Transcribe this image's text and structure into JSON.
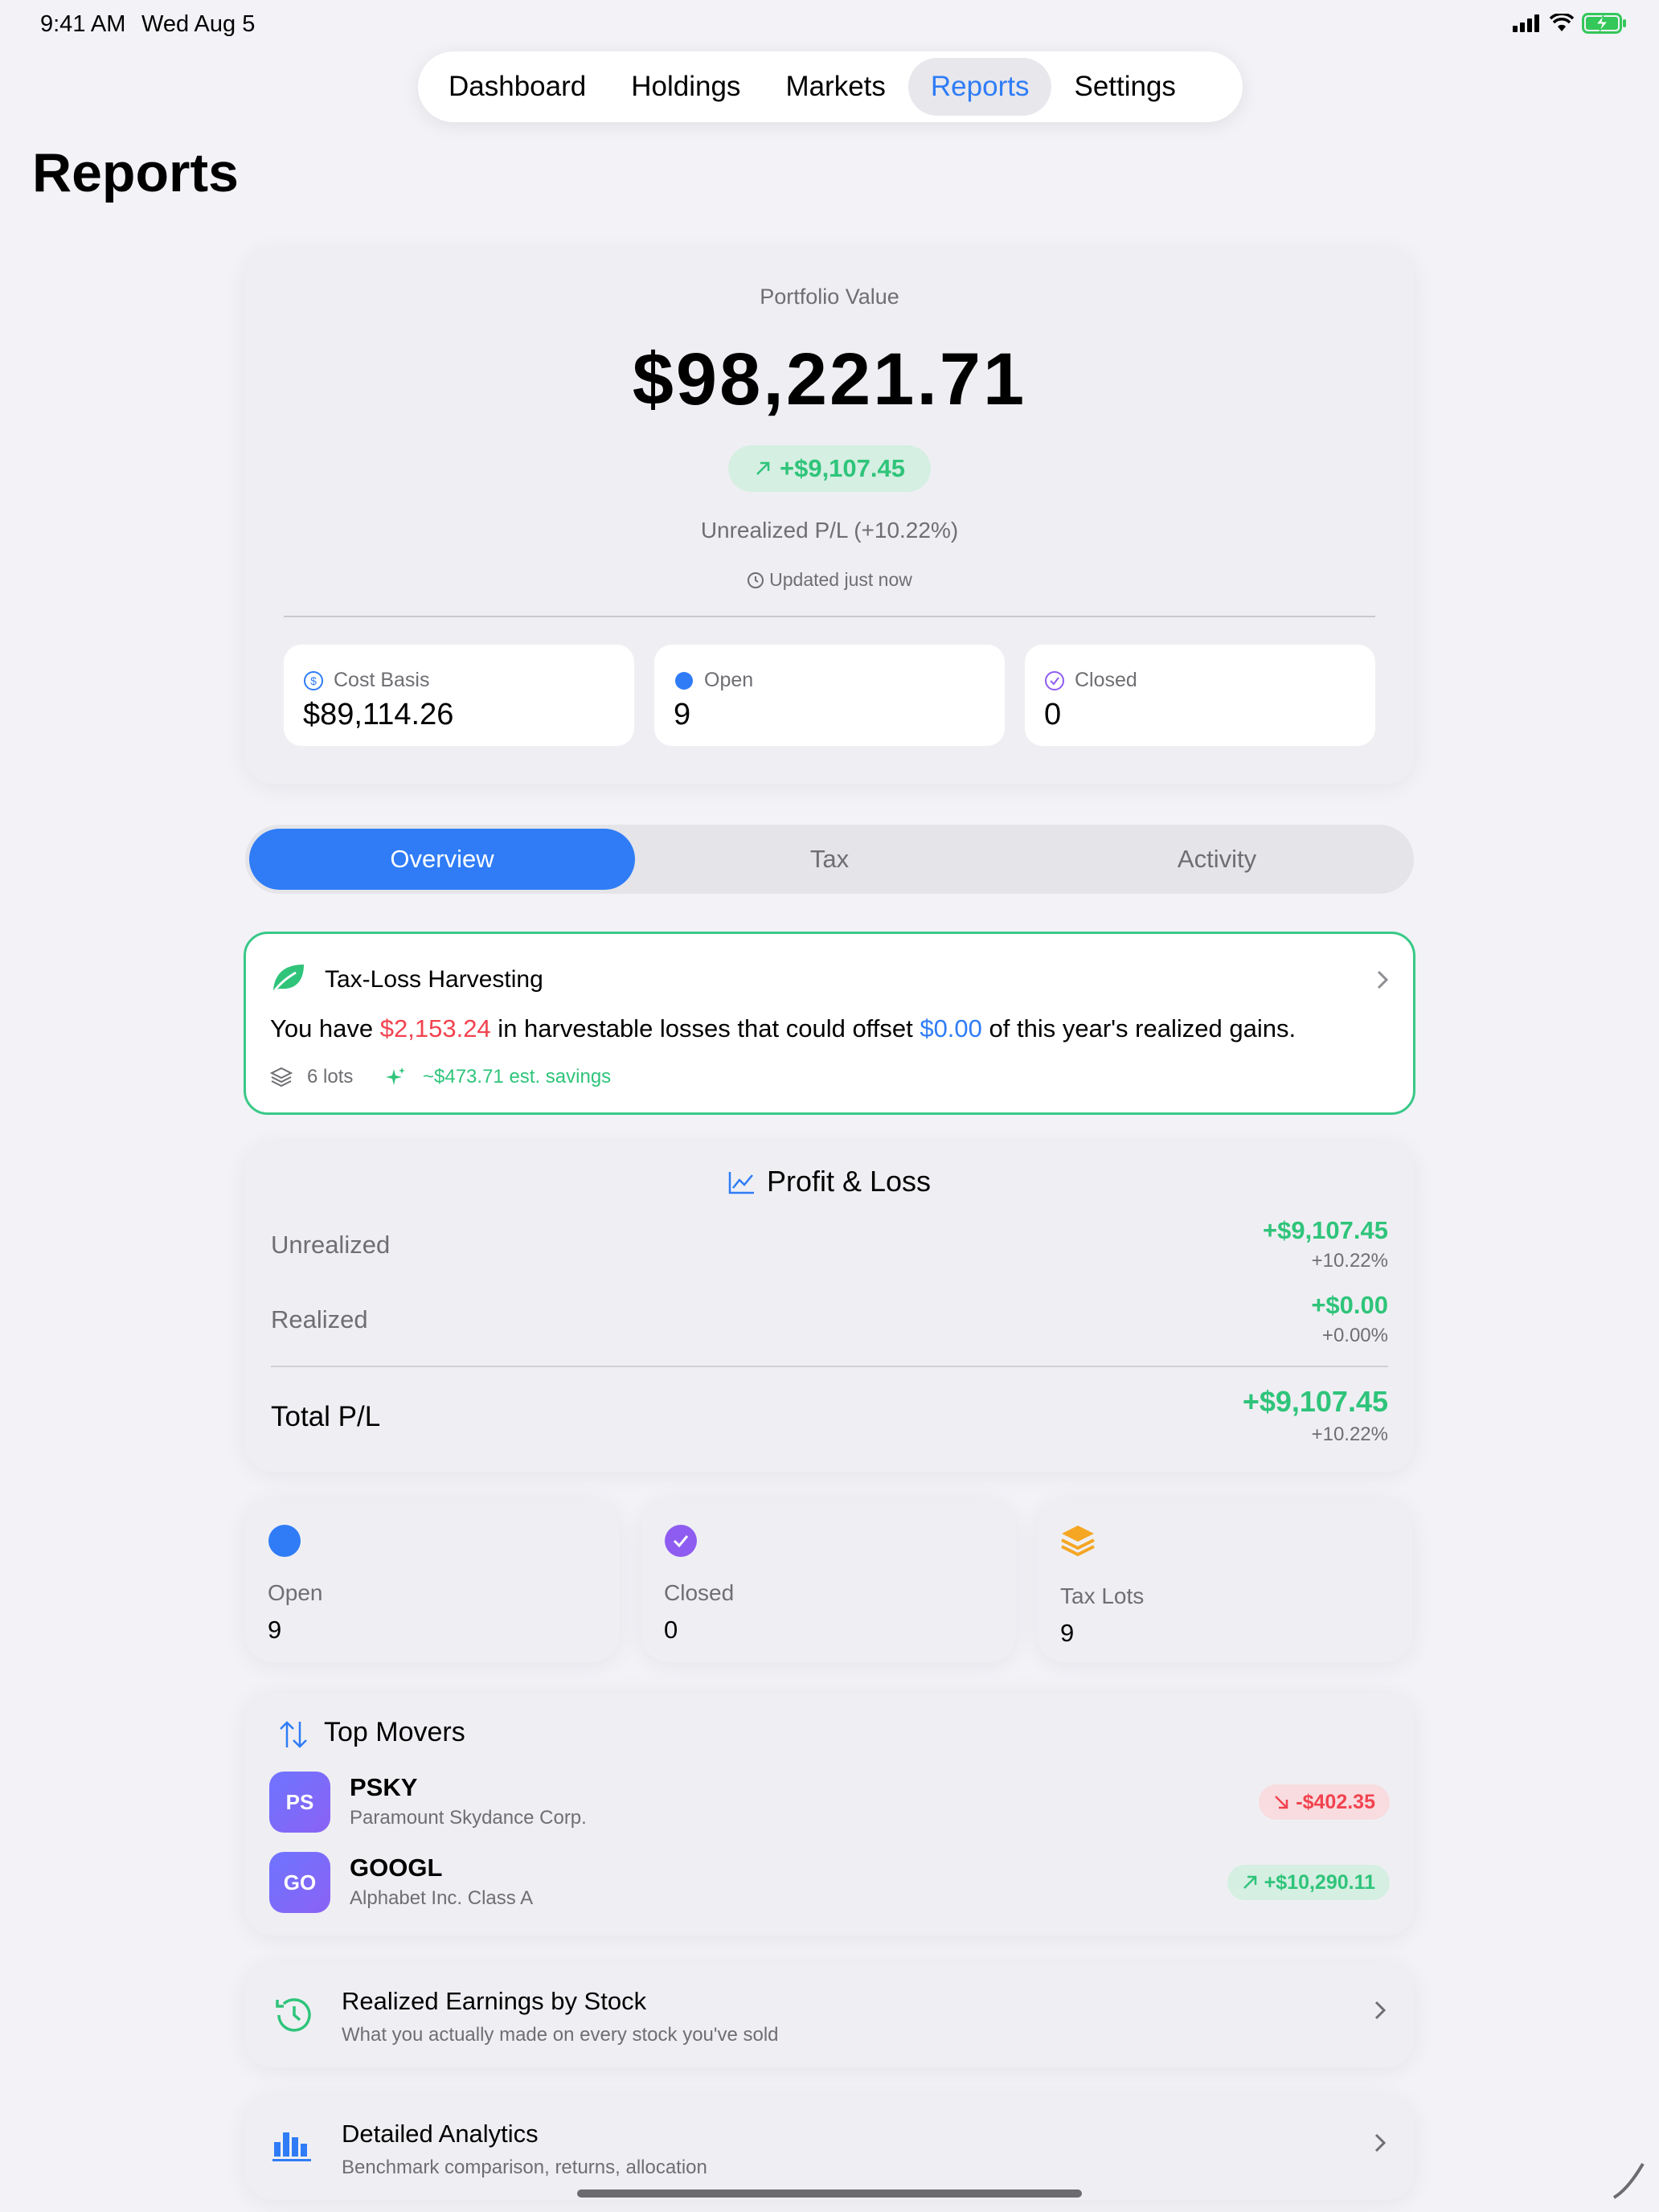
{
  "status": {
    "time": "9:41 AM",
    "date": "Wed Aug 5"
  },
  "nav": {
    "items": [
      "Dashboard",
      "Holdings",
      "Markets",
      "Reports",
      "Settings"
    ],
    "active": "Reports"
  },
  "page": {
    "title": "Reports"
  },
  "portfolio": {
    "label": "Portfolio Value",
    "value": "$98,221.71",
    "change": "+$9,107.45",
    "unrealized": "Unrealized P/L (+10.22%)",
    "updated": "Updated just now",
    "stats": [
      {
        "label": "Cost Basis",
        "value": "$89,114.26",
        "icon": "dollar-circle-icon"
      },
      {
        "label": "Open",
        "value": "9",
        "icon": "blue-dot-icon"
      },
      {
        "label": "Closed",
        "value": "0",
        "icon": "check-circle-icon"
      }
    ]
  },
  "segments": {
    "items": [
      "Overview",
      "Tax",
      "Activity"
    ],
    "active": "Overview"
  },
  "tax_loss": {
    "title": "Tax-Loss Harvesting",
    "text_1": "You have ",
    "losses": "$2,153.24",
    "text_2": " in harvestable losses that could offset ",
    "offset": "$0.00",
    "text_3": " of this year's realized gains.",
    "lots": "6 lots",
    "savings": "~$473.71 est. savings"
  },
  "pl": {
    "title": "Profit & Loss",
    "rows": [
      {
        "label": "Unrealized",
        "value": "+$9,107.45",
        "pct": "+10.22%"
      },
      {
        "label": "Realized",
        "value": "+$0.00",
        "pct": "+0.00%"
      }
    ],
    "total": {
      "label": "Total P/L",
      "value": "+$9,107.45",
      "pct": "+10.22%"
    }
  },
  "mini_stats": [
    {
      "label": "Open",
      "value": "9"
    },
    {
      "label": "Closed",
      "value": "0"
    },
    {
      "label": "Tax Lots",
      "value": "9"
    }
  ],
  "top_movers": {
    "title": "Top Movers",
    "items": [
      {
        "initials": "PS",
        "ticker": "PSKY",
        "name": "Paramount Skydance Corp.",
        "change": "-$402.35",
        "direction": "down"
      },
      {
        "initials": "GO",
        "ticker": "GOOGL",
        "name": "Alphabet Inc. Class A",
        "change": "+$10,290.11",
        "direction": "up"
      }
    ]
  },
  "links": [
    {
      "title": "Realized Earnings by Stock",
      "subtitle": "What you actually made on every stock you've sold"
    },
    {
      "title": "Detailed Analytics",
      "subtitle": "Benchmark comparison, returns, allocation"
    }
  ],
  "colors": {
    "accent": "#2f7cf6",
    "positive": "#2fc47a",
    "negative": "#f2434f",
    "purple": "#8e5cf0",
    "orange": "#f5a623"
  }
}
